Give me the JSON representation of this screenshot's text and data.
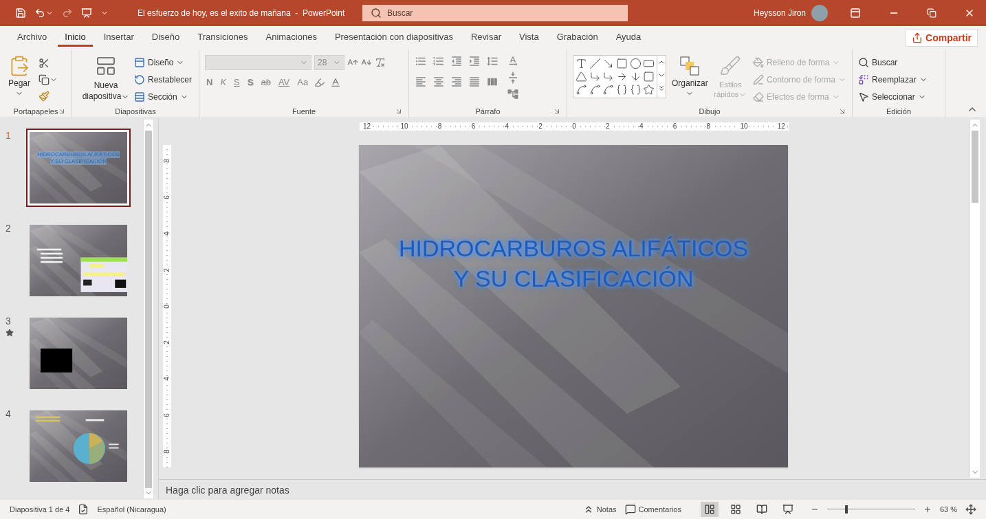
{
  "title_bar": {
    "document_title": "El esfuerzo de hoy, es el exito de mañana  -  PowerPoint",
    "search": {
      "placeholder": "Buscar"
    },
    "user_name": "Heysson Jiron"
  },
  "tabs": [
    {
      "label": "Archivo",
      "selected": false
    },
    {
      "label": "Inicio",
      "selected": true
    },
    {
      "label": "Insertar",
      "selected": false
    },
    {
      "label": "Diseño",
      "selected": false
    },
    {
      "label": "Transiciones",
      "selected": false
    },
    {
      "label": "Animaciones",
      "selected": false
    },
    {
      "label": "Presentación con diapositivas",
      "selected": false
    },
    {
      "label": "Revisar",
      "selected": false
    },
    {
      "label": "Vista",
      "selected": false
    },
    {
      "label": "Grabación",
      "selected": false
    },
    {
      "label": "Ayuda",
      "selected": false
    }
  ],
  "share_button": {
    "label": "Compartir"
  },
  "ribbon_groups": [
    {
      "kind": "clipboard",
      "label": "Portapapeles",
      "launcher": true,
      "paste_label": "Pegar"
    },
    {
      "kind": "slides",
      "label": "Diapositivas",
      "launcher": false,
      "new_slide_label": "Nueva diapositiva",
      "commands": [
        {
          "kind": "layout",
          "label": "Diseño",
          "dropdown": true
        },
        {
          "kind": "reset",
          "label": "Restablecer",
          "dropdown": false
        },
        {
          "kind": "section",
          "label": "Sección",
          "dropdown": true
        }
      ]
    },
    {
      "kind": "font",
      "label": "Fuente",
      "launcher": true,
      "font_size": "28",
      "format_buttons": [
        {
          "kind": "bold",
          "label": "N"
        },
        {
          "kind": "italic",
          "label": "K"
        },
        {
          "kind": "underline",
          "label": "S"
        },
        {
          "kind": "shadow",
          "label": "S"
        },
        {
          "kind": "strike",
          "label": "ab"
        },
        {
          "kind": "spacing",
          "label": "AV"
        },
        {
          "kind": "case",
          "label": "Aa"
        }
      ]
    },
    {
      "kind": "paragraph",
      "label": "Párrafo",
      "launcher": true
    },
    {
      "kind": "drawing",
      "label": "Dibujo",
      "launcher": true,
      "arrange_label": "Organizar",
      "quick_styles": {
        "label": "Estilos rápidos",
        "disabled": true
      },
      "commands": [
        {
          "kind": "fill",
          "label": "Relleno de forma",
          "disabled": true
        },
        {
          "kind": "outline",
          "label": "Contorno de forma",
          "disabled": true
        },
        {
          "kind": "effects",
          "label": "Efectos de forma",
          "disabled": true
        }
      ]
    },
    {
      "kind": "editing",
      "label": "Edición",
      "launcher": false,
      "commands": [
        {
          "kind": "find",
          "label": "Buscar",
          "dropdown": false
        },
        {
          "kind": "replace",
          "label": "Reemplazar",
          "dropdown": true
        },
        {
          "kind": "select",
          "label": "Seleccionar",
          "dropdown": true
        }
      ]
    }
  ],
  "slides_pane": {
    "thumbnails": [
      {
        "number": "1",
        "selected": true,
        "animated": false,
        "kind": "title",
        "title_lines": [
          "HIDROCARBUROS ALIFÁTICOS",
          "Y SU CLASIFICACIÓN"
        ]
      },
      {
        "number": "2",
        "selected": false,
        "animated": false,
        "kind": "picture"
      },
      {
        "number": "3",
        "selected": false,
        "animated": true,
        "kind": "picture"
      },
      {
        "number": "4",
        "selected": false,
        "animated": false,
        "kind": "picture"
      }
    ]
  },
  "editor": {
    "horizontal_ruler": [
      "12",
      "10",
      "8",
      "6",
      "4",
      "2",
      "0",
      "2",
      "4",
      "6",
      "8",
      "10",
      "12"
    ],
    "vertical_ruler": [
      "8",
      "6",
      "4",
      "2",
      "0",
      "2",
      "4",
      "6",
      "8"
    ],
    "slide": {
      "title_lines": [
        "HIDROCARBUROS ALIFÁTICOS",
        "Y SU CLASIFICACIÓN"
      ]
    },
    "notes": {
      "placeholder": "Haga clic para agregar notas"
    }
  },
  "status_bar": {
    "slide_indicator": "Diapositiva 1 de 4",
    "language": "Español (Nicaragua)",
    "notes_button": "Notas",
    "comments_button": "Comentarios",
    "views": [
      {
        "kind": "normal",
        "selected": true
      },
      {
        "kind": "sorter",
        "selected": false
      },
      {
        "kind": "reading",
        "selected": false
      },
      {
        "kind": "slideshow",
        "selected": false
      }
    ],
    "zoom": {
      "level": 0.22,
      "reading": "63 %"
    }
  }
}
